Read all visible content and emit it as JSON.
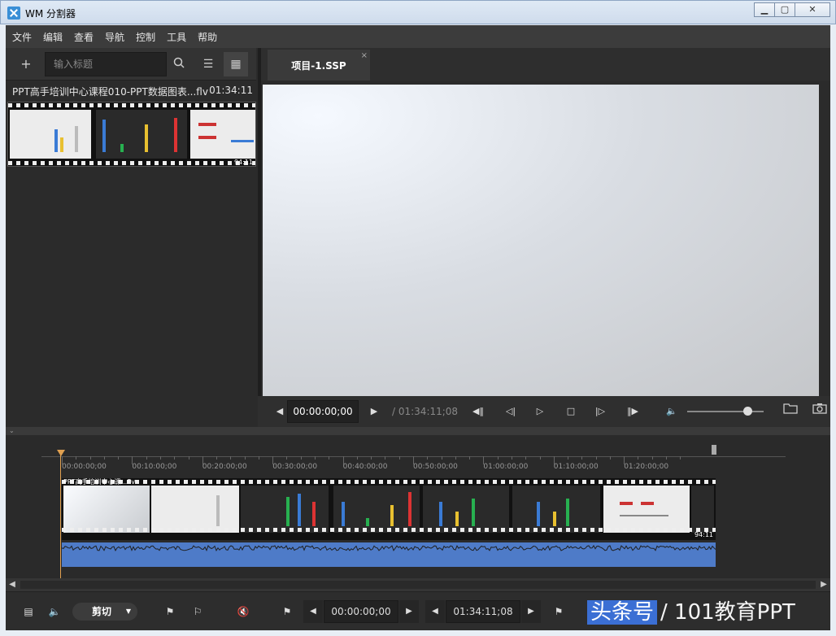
{
  "window": {
    "title": "WM 分割器",
    "buttons": [
      "minimize",
      "maximize",
      "close"
    ]
  },
  "menu": [
    "文件",
    "编辑",
    "查看",
    "导航",
    "控制",
    "工具",
    "帮助"
  ],
  "left_toolbar": {
    "search_placeholder": "输入标题"
  },
  "media": {
    "title": "PPT高手培训中心课程010-PPT数据图表...flv",
    "duration": "01:34:11",
    "strip_label": "94:11"
  },
  "tab": {
    "label": "项目-1.SSP",
    "close": "×"
  },
  "player": {
    "current_time": "00:00:00;00",
    "total_time": "/ 01:34:11;08",
    "volume_fraction": 0.8
  },
  "timeline": {
    "ticks": [
      "00:00:00;00",
      "00:10:00;00",
      "00:20:00;00",
      "00:30:00;00",
      "00:40:00;00",
      "00:50:00;00",
      "01:00:00;00",
      "01:10:00;00",
      "01:20:00;00"
    ],
    "track_label": "PPT高手培训中心课...flv",
    "track_duration": "94:11"
  },
  "bottom": {
    "mode": "剪切",
    "start_time": "00:00:00;00",
    "end_time": "01:34:11;08"
  },
  "watermark": {
    "part1": "头条号",
    "part2": "/ 101教育PPT"
  },
  "colors": {
    "panel": "#2b2b2b",
    "playhead": "#e0a050",
    "waveform": "#4e7bc8"
  }
}
